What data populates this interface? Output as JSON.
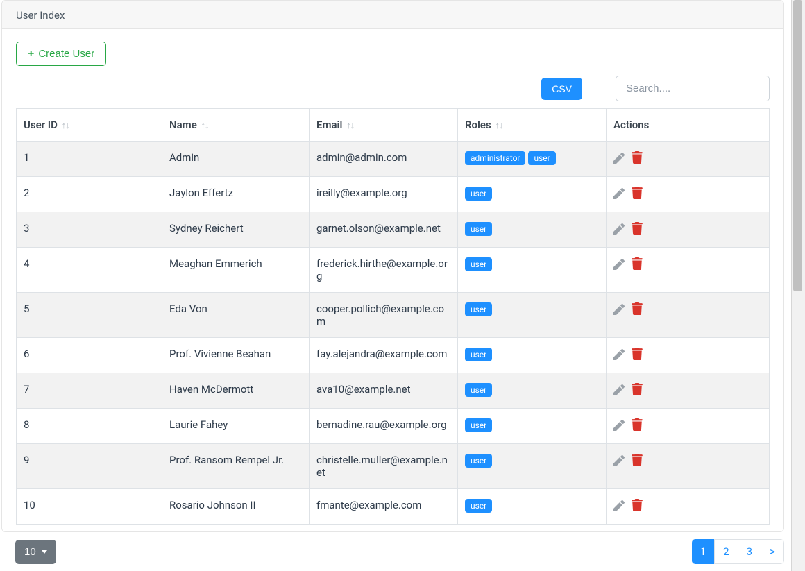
{
  "header": {
    "title": "User Index"
  },
  "toolbar": {
    "create_label": "Create User",
    "csv_label": "CSV",
    "search_placeholder": "Search...."
  },
  "columns": {
    "user_id": "User ID",
    "name": "Name",
    "email": "Email",
    "roles": "Roles",
    "actions": "Actions"
  },
  "rows": [
    {
      "id": "1",
      "name": "Admin",
      "email": "admin@admin.com",
      "roles": [
        "administrator",
        "user"
      ]
    },
    {
      "id": "2",
      "name": "Jaylon Effertz",
      "email": "ireilly@example.org",
      "roles": [
        "user"
      ]
    },
    {
      "id": "3",
      "name": "Sydney Reichert",
      "email": "garnet.olson@example.net",
      "roles": [
        "user"
      ]
    },
    {
      "id": "4",
      "name": "Meaghan Emmerich",
      "email": "frederick.hirthe@example.org",
      "roles": [
        "user"
      ]
    },
    {
      "id": "5",
      "name": "Eda Von",
      "email": "cooper.pollich@example.com",
      "roles": [
        "user"
      ]
    },
    {
      "id": "6",
      "name": "Prof. Vivienne Beahan",
      "email": "fay.alejandra@example.com",
      "roles": [
        "user"
      ]
    },
    {
      "id": "7",
      "name": "Haven McDermott",
      "email": "ava10@example.net",
      "roles": [
        "user"
      ]
    },
    {
      "id": "8",
      "name": "Laurie Fahey",
      "email": "bernadine.rau@example.org",
      "roles": [
        "user"
      ]
    },
    {
      "id": "9",
      "name": "Prof. Ransom Rempel Jr.",
      "email": "christelle.muller@example.net",
      "roles": [
        "user"
      ]
    },
    {
      "id": "10",
      "name": "Rosario Johnson II",
      "email": "fmante@example.com",
      "roles": [
        "user"
      ]
    }
  ],
  "page_size_label": "10",
  "pagination": {
    "pages": [
      "1",
      "2",
      "3"
    ],
    "active": "1",
    "next_label": ">"
  }
}
